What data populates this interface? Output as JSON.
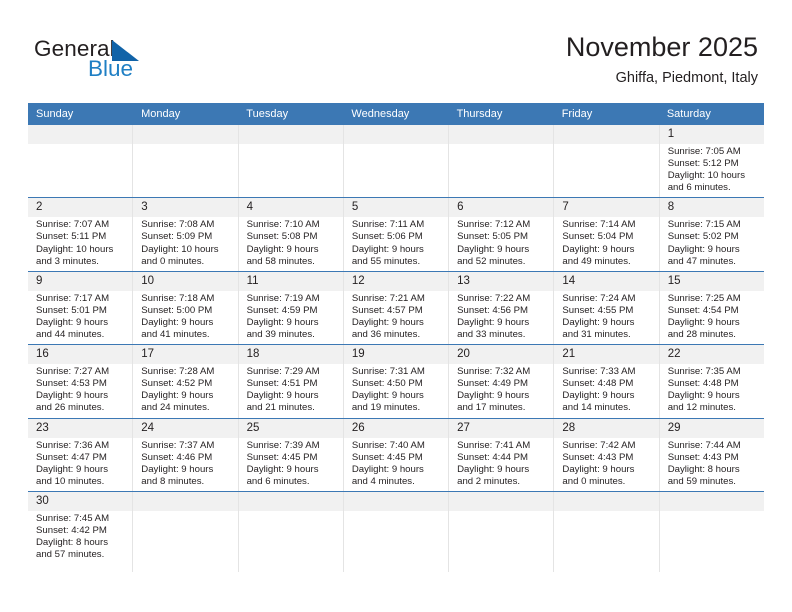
{
  "brand": {
    "name_part1": "General",
    "name_part2": "Blue",
    "flag_icon": "blue-flag-triangle-icon",
    "colors": {
      "dark": "#231f20",
      "blue": "#1f7fc4",
      "header_blue": "#3c78b4",
      "band_gray": "#f1f1f1"
    }
  },
  "header": {
    "title": "November 2025",
    "subtitle": "Ghiffa, Piedmont, Italy"
  },
  "calendar": {
    "weekday_headers": [
      "Sunday",
      "Monday",
      "Tuesday",
      "Wednesday",
      "Thursday",
      "Friday",
      "Saturday"
    ],
    "weeks": [
      [
        {
          "day": "",
          "lines": [],
          "empty": true
        },
        {
          "day": "",
          "lines": [],
          "empty": true
        },
        {
          "day": "",
          "lines": [],
          "empty": true
        },
        {
          "day": "",
          "lines": [],
          "empty": true
        },
        {
          "day": "",
          "lines": [],
          "empty": true
        },
        {
          "day": "",
          "lines": [],
          "empty": true
        },
        {
          "day": "1",
          "lines": [
            "Sunrise: 7:05 AM",
            "Sunset: 5:12 PM",
            "Daylight: 10 hours",
            "and 6 minutes."
          ],
          "empty": false
        }
      ],
      [
        {
          "day": "2",
          "lines": [
            "Sunrise: 7:07 AM",
            "Sunset: 5:11 PM",
            "Daylight: 10 hours",
            "and 3 minutes."
          ],
          "empty": false
        },
        {
          "day": "3",
          "lines": [
            "Sunrise: 7:08 AM",
            "Sunset: 5:09 PM",
            "Daylight: 10 hours",
            "and 0 minutes."
          ],
          "empty": false
        },
        {
          "day": "4",
          "lines": [
            "Sunrise: 7:10 AM",
            "Sunset: 5:08 PM",
            "Daylight: 9 hours",
            "and 58 minutes."
          ],
          "empty": false
        },
        {
          "day": "5",
          "lines": [
            "Sunrise: 7:11 AM",
            "Sunset: 5:06 PM",
            "Daylight: 9 hours",
            "and 55 minutes."
          ],
          "empty": false
        },
        {
          "day": "6",
          "lines": [
            "Sunrise: 7:12 AM",
            "Sunset: 5:05 PM",
            "Daylight: 9 hours",
            "and 52 minutes."
          ],
          "empty": false
        },
        {
          "day": "7",
          "lines": [
            "Sunrise: 7:14 AM",
            "Sunset: 5:04 PM",
            "Daylight: 9 hours",
            "and 49 minutes."
          ],
          "empty": false
        },
        {
          "day": "8",
          "lines": [
            "Sunrise: 7:15 AM",
            "Sunset: 5:02 PM",
            "Daylight: 9 hours",
            "and 47 minutes."
          ],
          "empty": false
        }
      ],
      [
        {
          "day": "9",
          "lines": [
            "Sunrise: 7:17 AM",
            "Sunset: 5:01 PM",
            "Daylight: 9 hours",
            "and 44 minutes."
          ],
          "empty": false
        },
        {
          "day": "10",
          "lines": [
            "Sunrise: 7:18 AM",
            "Sunset: 5:00 PM",
            "Daylight: 9 hours",
            "and 41 minutes."
          ],
          "empty": false
        },
        {
          "day": "11",
          "lines": [
            "Sunrise: 7:19 AM",
            "Sunset: 4:59 PM",
            "Daylight: 9 hours",
            "and 39 minutes."
          ],
          "empty": false
        },
        {
          "day": "12",
          "lines": [
            "Sunrise: 7:21 AM",
            "Sunset: 4:57 PM",
            "Daylight: 9 hours",
            "and 36 minutes."
          ],
          "empty": false
        },
        {
          "day": "13",
          "lines": [
            "Sunrise: 7:22 AM",
            "Sunset: 4:56 PM",
            "Daylight: 9 hours",
            "and 33 minutes."
          ],
          "empty": false
        },
        {
          "day": "14",
          "lines": [
            "Sunrise: 7:24 AM",
            "Sunset: 4:55 PM",
            "Daylight: 9 hours",
            "and 31 minutes."
          ],
          "empty": false
        },
        {
          "day": "15",
          "lines": [
            "Sunrise: 7:25 AM",
            "Sunset: 4:54 PM",
            "Daylight: 9 hours",
            "and 28 minutes."
          ],
          "empty": false
        }
      ],
      [
        {
          "day": "16",
          "lines": [
            "Sunrise: 7:27 AM",
            "Sunset: 4:53 PM",
            "Daylight: 9 hours",
            "and 26 minutes."
          ],
          "empty": false
        },
        {
          "day": "17",
          "lines": [
            "Sunrise: 7:28 AM",
            "Sunset: 4:52 PM",
            "Daylight: 9 hours",
            "and 24 minutes."
          ],
          "empty": false
        },
        {
          "day": "18",
          "lines": [
            "Sunrise: 7:29 AM",
            "Sunset: 4:51 PM",
            "Daylight: 9 hours",
            "and 21 minutes."
          ],
          "empty": false
        },
        {
          "day": "19",
          "lines": [
            "Sunrise: 7:31 AM",
            "Sunset: 4:50 PM",
            "Daylight: 9 hours",
            "and 19 minutes."
          ],
          "empty": false
        },
        {
          "day": "20",
          "lines": [
            "Sunrise: 7:32 AM",
            "Sunset: 4:49 PM",
            "Daylight: 9 hours",
            "and 17 minutes."
          ],
          "empty": false
        },
        {
          "day": "21",
          "lines": [
            "Sunrise: 7:33 AM",
            "Sunset: 4:48 PM",
            "Daylight: 9 hours",
            "and 14 minutes."
          ],
          "empty": false
        },
        {
          "day": "22",
          "lines": [
            "Sunrise: 7:35 AM",
            "Sunset: 4:48 PM",
            "Daylight: 9 hours",
            "and 12 minutes."
          ],
          "empty": false
        }
      ],
      [
        {
          "day": "23",
          "lines": [
            "Sunrise: 7:36 AM",
            "Sunset: 4:47 PM",
            "Daylight: 9 hours",
            "and 10 minutes."
          ],
          "empty": false
        },
        {
          "day": "24",
          "lines": [
            "Sunrise: 7:37 AM",
            "Sunset: 4:46 PM",
            "Daylight: 9 hours",
            "and 8 minutes."
          ],
          "empty": false
        },
        {
          "day": "25",
          "lines": [
            "Sunrise: 7:39 AM",
            "Sunset: 4:45 PM",
            "Daylight: 9 hours",
            "and 6 minutes."
          ],
          "empty": false
        },
        {
          "day": "26",
          "lines": [
            "Sunrise: 7:40 AM",
            "Sunset: 4:45 PM",
            "Daylight: 9 hours",
            "and 4 minutes."
          ],
          "empty": false
        },
        {
          "day": "27",
          "lines": [
            "Sunrise: 7:41 AM",
            "Sunset: 4:44 PM",
            "Daylight: 9 hours",
            "and 2 minutes."
          ],
          "empty": false
        },
        {
          "day": "28",
          "lines": [
            "Sunrise: 7:42 AM",
            "Sunset: 4:43 PM",
            "Daylight: 9 hours",
            "and 0 minutes."
          ],
          "empty": false
        },
        {
          "day": "29",
          "lines": [
            "Sunrise: 7:44 AM",
            "Sunset: 4:43 PM",
            "Daylight: 8 hours",
            "and 59 minutes."
          ],
          "empty": false
        }
      ],
      [
        {
          "day": "30",
          "lines": [
            "Sunrise: 7:45 AM",
            "Sunset: 4:42 PM",
            "Daylight: 8 hours",
            "and 57 minutes."
          ],
          "empty": false
        },
        {
          "day": "",
          "lines": [],
          "empty": true
        },
        {
          "day": "",
          "lines": [],
          "empty": true
        },
        {
          "day": "",
          "lines": [],
          "empty": true
        },
        {
          "day": "",
          "lines": [],
          "empty": true
        },
        {
          "day": "",
          "lines": [],
          "empty": true
        },
        {
          "day": "",
          "lines": [],
          "empty": true
        }
      ]
    ]
  }
}
